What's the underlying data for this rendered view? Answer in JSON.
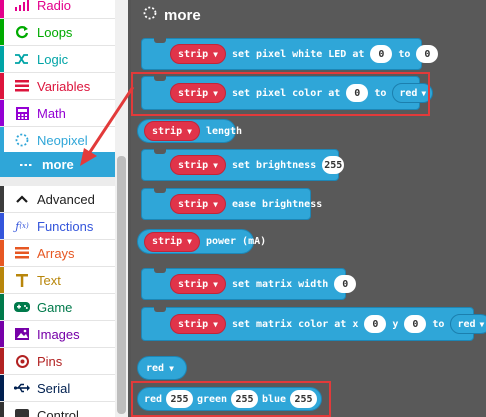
{
  "toolbox": {
    "categories": [
      {
        "label": "Radio",
        "color": "#e3008c",
        "icon": "radio-icon"
      },
      {
        "label": "Loops",
        "color": "#00aa00",
        "icon": "loops-icon"
      },
      {
        "label": "Logic",
        "color": "#00a4a6",
        "icon": "logic-icon"
      },
      {
        "label": "Variables",
        "color": "#dc143c",
        "icon": "variables-icon"
      },
      {
        "label": "Math",
        "color": "#9400d3",
        "icon": "math-icon"
      },
      {
        "label": "Neopixel",
        "color": "#2FA6D8",
        "icon": "neopixel-icon"
      },
      {
        "label": "more",
        "color": "#ffffff",
        "icon": "more-icon"
      },
      {
        "label": "Advanced",
        "color": "#3c3c3c",
        "icon": "chevron-up-icon"
      },
      {
        "label": "Functions",
        "color": "#3455db",
        "icon": "functions-icon"
      },
      {
        "label": "Arrays",
        "color": "#e65722",
        "icon": "arrays-icon"
      },
      {
        "label": "Text",
        "color": "#b8860b",
        "icon": "text-icon"
      },
      {
        "label": "Game",
        "color": "#007a4b",
        "icon": "game-icon"
      },
      {
        "label": "Images",
        "color": "#7600a8",
        "icon": "images-icon"
      },
      {
        "label": "Pins",
        "color": "#b22222",
        "icon": "pins-icon"
      },
      {
        "label": "Serial",
        "color": "#002050",
        "icon": "serial-icon"
      },
      {
        "label": "Control",
        "color": "#333333",
        "icon": "control-icon"
      }
    ]
  },
  "flyout": {
    "title": "more",
    "strip_label": "strip",
    "blocks": {
      "set_white": {
        "text1": "set pixel white LED at",
        "v1": "0",
        "text2": "to",
        "v2": "0"
      },
      "set_color": {
        "text1": "set pixel color at",
        "v1": "0",
        "text2": "to",
        "dd": "red"
      },
      "length": {
        "text": "length"
      },
      "brightness": {
        "text": "set brightness",
        "v": "255"
      },
      "ease": {
        "text": "ease brightness"
      },
      "power": {
        "text": "power (mA)"
      },
      "matrix_width": {
        "text": "set matrix width",
        "v": "0"
      },
      "matrix_color": {
        "text1": "set matrix color at x",
        "v1": "0",
        "text2": "y",
        "v2": "0",
        "text3": "to",
        "dd": "red"
      },
      "red": {
        "dd": "red"
      },
      "rgb": {
        "t1": "red",
        "v1": "255",
        "t2": "green",
        "v2": "255",
        "t3": "blue",
        "v3": "255"
      }
    }
  },
  "colors": {
    "accent": "#2FA6D8",
    "pill": "#e0344a",
    "highlight": "#e23a3a"
  }
}
